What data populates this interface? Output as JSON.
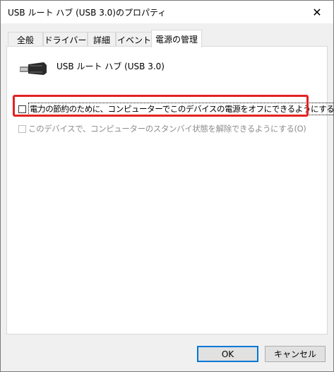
{
  "window": {
    "title": "USB ルート ハブ (USB 3.0)のプロパティ",
    "close_glyph": "✕"
  },
  "tabs": [
    {
      "label": "全般"
    },
    {
      "label": "ドライバー"
    },
    {
      "label": "詳細"
    },
    {
      "label": "イベント"
    },
    {
      "label": "電源の管理",
      "active": true
    }
  ],
  "device": {
    "icon": "usb-connector-icon",
    "name": "USB ルート ハブ (USB 3.0)"
  },
  "options": {
    "allow_power_off": {
      "label": "電力の節約のために、コンピューターでこのデバイスの電源をオフにできるようにする(A)",
      "checked": false,
      "enabled": true
    },
    "allow_wake": {
      "label": "このデバイスで、コンピューターのスタンバイ状態を解除できるようにする(O)",
      "checked": false,
      "enabled": false
    }
  },
  "buttons": {
    "ok": "OK",
    "cancel": "キャンセル"
  },
  "colors": {
    "annotation": "#e42222",
    "default_button_border": "#0078d7"
  }
}
